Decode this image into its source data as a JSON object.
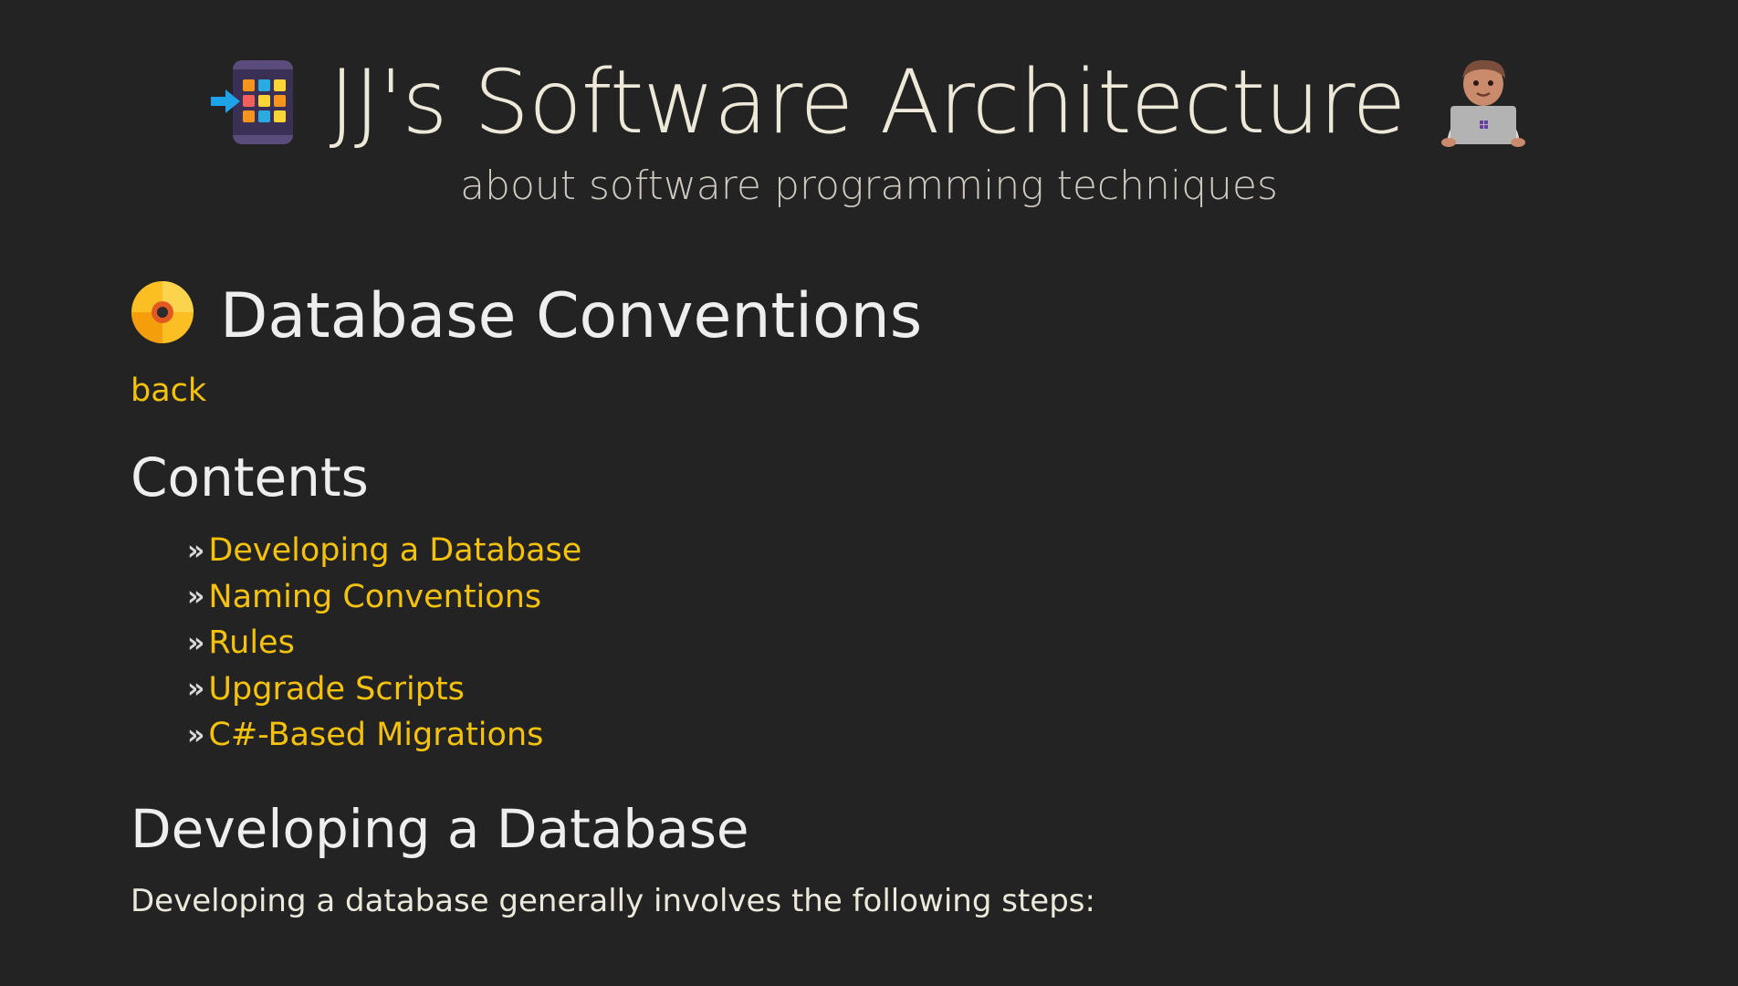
{
  "header": {
    "title": "JJ's Software Architecture",
    "subtitle": "about software programming techniques",
    "logo_icon": "app-grid-enter-icon",
    "coder_icon": "technologist-laptop-icon"
  },
  "page": {
    "title": "Database Conventions",
    "title_icon": "optical-disc-icon",
    "back_label": "back"
  },
  "contents": {
    "heading": "Contents",
    "bullet": "»",
    "items": [
      "Developing a Database",
      "Naming Conventions",
      "Rules",
      "Upgrade Scripts",
      "C#-Based Migrations"
    ]
  },
  "section": {
    "heading": "Developing a Database",
    "intro": "Developing a database generally involves the following steps:"
  },
  "colors": {
    "background": "#232323",
    "link": "#f4c20d",
    "text": "#ece8dc"
  }
}
